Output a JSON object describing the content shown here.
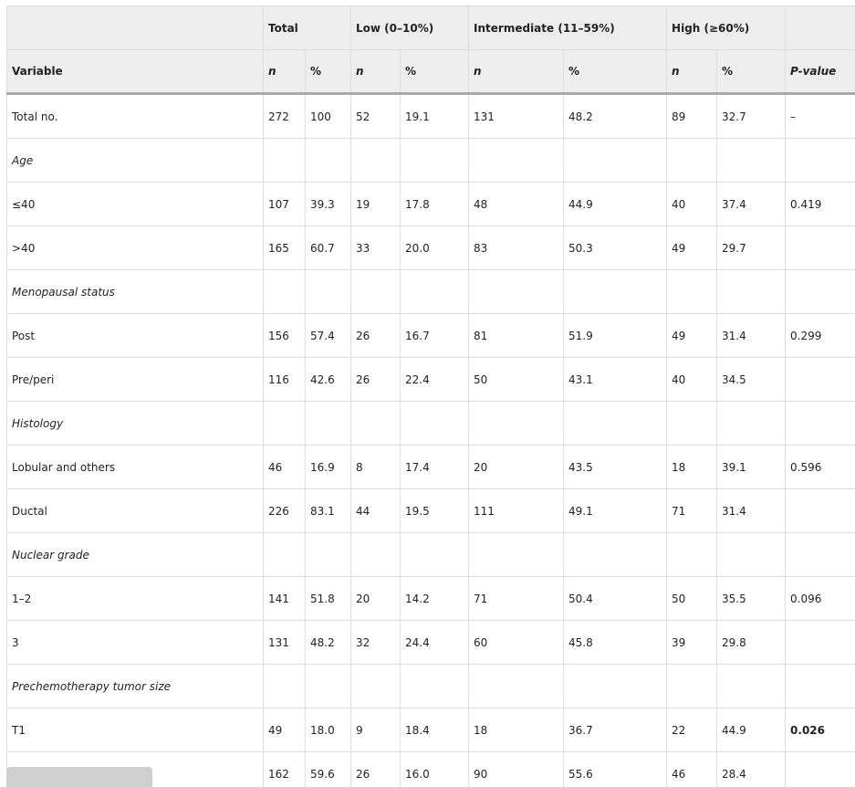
{
  "table": {
    "groups": {
      "variable_blank": "",
      "total": "Total",
      "low": "Low (0–10%)",
      "intermediate": "Intermediate (11–59%)",
      "high": "High (≥60%)",
      "pvalue_blank": ""
    },
    "subheaders": {
      "variable": "Variable",
      "n": "n",
      "pct": "%",
      "pvalue": "P-value"
    },
    "rows": [
      {
        "type": "data",
        "label": "Total no.",
        "cells": [
          "272",
          "100",
          "52",
          "19.1",
          "131",
          "48.2",
          "89",
          "32.7",
          "–"
        ],
        "bold_p": false
      },
      {
        "type": "section",
        "label": "Age"
      },
      {
        "type": "data",
        "label": "≤40",
        "cells": [
          "107",
          "39.3",
          "19",
          "17.8",
          "48",
          "44.9",
          "40",
          "37.4",
          "0.419"
        ],
        "bold_p": false
      },
      {
        "type": "data",
        "label": ">40",
        "cells": [
          "165",
          "60.7",
          "33",
          "20.0",
          "83",
          "50.3",
          "49",
          "29.7",
          ""
        ],
        "bold_p": false
      },
      {
        "type": "section",
        "label": "Menopausal status"
      },
      {
        "type": "data",
        "label": "Post",
        "cells": [
          "156",
          "57.4",
          "26",
          "16.7",
          "81",
          "51.9",
          "49",
          "31.4",
          "0.299"
        ],
        "bold_p": false
      },
      {
        "type": "data",
        "label": "Pre/peri",
        "cells": [
          "116",
          "42.6",
          "26",
          "22.4",
          "50",
          "43.1",
          "40",
          "34.5",
          ""
        ],
        "bold_p": false
      },
      {
        "type": "section",
        "label": "Histology"
      },
      {
        "type": "data",
        "label": "Lobular and others",
        "cells": [
          "46",
          "16.9",
          "8",
          "17.4",
          "20",
          "43.5",
          "18",
          "39.1",
          "0.596"
        ],
        "bold_p": false
      },
      {
        "type": "data",
        "label": "Ductal",
        "cells": [
          "226",
          "83.1",
          "44",
          "19.5",
          "111",
          "49.1",
          "71",
          "31.4",
          ""
        ],
        "bold_p": false
      },
      {
        "type": "section",
        "label": "Nuclear grade"
      },
      {
        "type": "data",
        "label": "1–2",
        "cells": [
          "141",
          "51.8",
          "20",
          "14.2",
          "71",
          "50.4",
          "50",
          "35.5",
          "0.096"
        ],
        "bold_p": false
      },
      {
        "type": "data",
        "label": "3",
        "cells": [
          "131",
          "48.2",
          "32",
          "24.4",
          "60",
          "45.8",
          "39",
          "29.8",
          ""
        ],
        "bold_p": false
      },
      {
        "type": "section",
        "label": "Prechemotherapy tumor size"
      },
      {
        "type": "data",
        "label": "T1",
        "cells": [
          "49",
          "18.0",
          "9",
          "18.4",
          "18",
          "36.7",
          "22",
          "44.9",
          "0.026"
        ],
        "bold_p": true
      },
      {
        "type": "data",
        "label": "",
        "cells": [
          "162",
          "59.6",
          "26",
          "16.0",
          "90",
          "55.6",
          "46",
          "28.4",
          ""
        ],
        "bold_p": false
      }
    ]
  }
}
